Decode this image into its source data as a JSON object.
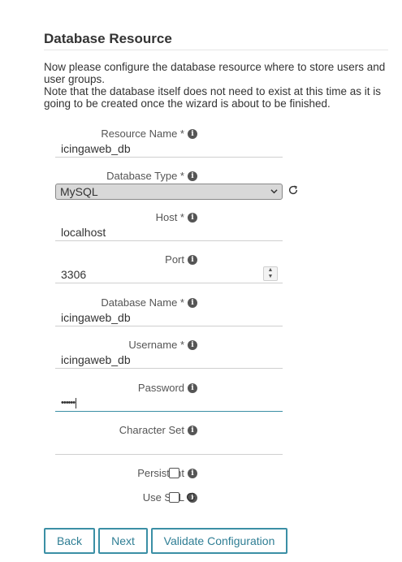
{
  "heading": "Database Resource",
  "intro": {
    "line1": "Now please configure the database resource where to store users and user groups.",
    "line2": "Note that the database itself does not need to exist at this time as it is going to be created once the wizard is about to be finished."
  },
  "fields": {
    "resource_name": {
      "label": "Resource Name *",
      "value": "icingaweb_db"
    },
    "database_type": {
      "label": "Database Type *",
      "value": "MySQL"
    },
    "host": {
      "label": "Host *",
      "value": "localhost"
    },
    "port": {
      "label": "Port",
      "value": "3306"
    },
    "database_name": {
      "label": "Database Name *",
      "value": "icingaweb_db"
    },
    "username": {
      "label": "Username *",
      "value": "icingaweb_db"
    },
    "password": {
      "label": "Password",
      "value": "••••••"
    },
    "character_set": {
      "label": "Character Set",
      "value": ""
    },
    "persistent": {
      "label": "Persistent",
      "checked": false
    },
    "use_ssl": {
      "label": "Use SSL",
      "checked": false
    }
  },
  "buttons": {
    "back": "Back",
    "next": "Next",
    "validate": "Validate Configuration"
  },
  "colors": {
    "accent": "#3b8fa5",
    "select_bg": "#d8d8d8"
  }
}
